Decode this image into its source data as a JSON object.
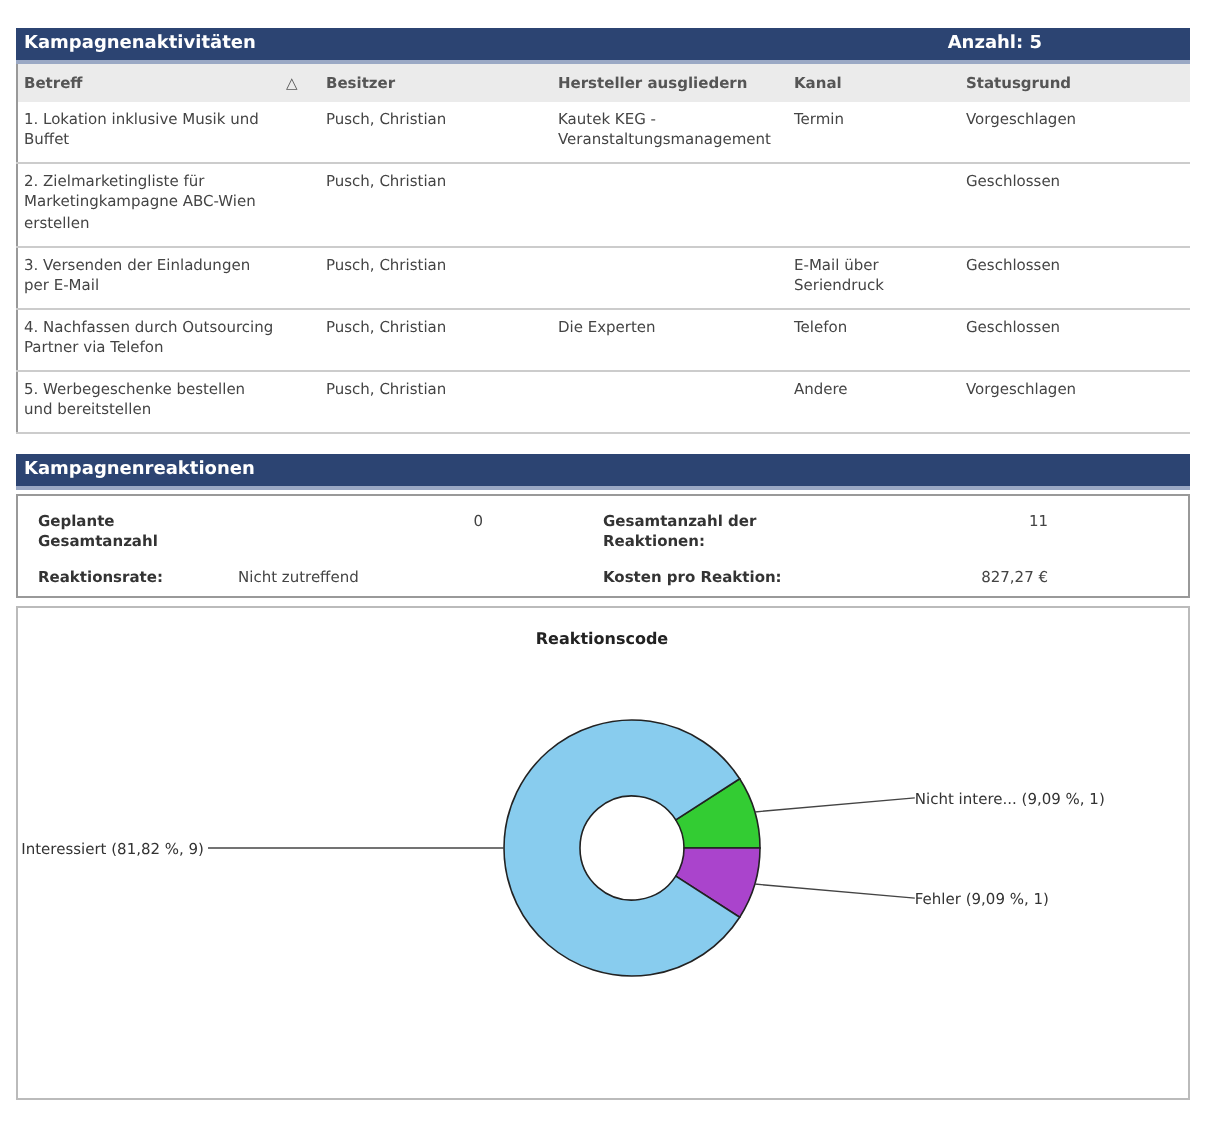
{
  "activities": {
    "title": "Kampagnenaktivitäten",
    "count": "Anzahl: 5",
    "sort_indicator": "△",
    "columns": [
      "Betreff",
      "Besitzer",
      "Hersteller ausgliedern",
      "Kanal",
      "Statusgrund"
    ],
    "rows": [
      {
        "cells": [
          "1. Lokation inklusive Musik und Buffet",
          "Pusch, Christian",
          "Kautek KEG - Veranstaltungsmanagement",
          "Termin",
          "Vorgeschlagen"
        ]
      },
      {
        "cells": [
          "2. Zielmarketingliste für Marketingkampagne ABC-Wien erstellen",
          "Pusch, Christian",
          "",
          "",
          "Geschlossen"
        ]
      },
      {
        "cells": [
          "3. Versenden der Einladungen per E-Mail",
          "Pusch, Christian",
          "",
          "E-Mail über Seriendruck",
          "Geschlossen"
        ]
      },
      {
        "cells": [
          "4. Nachfassen durch Outsourcing Partner via Telefon",
          "Pusch, Christian",
          "Die Experten",
          "Telefon",
          "Geschlossen"
        ]
      },
      {
        "cells": [
          "5. Werbegeschenke bestellen und bereitstellen",
          "Pusch, Christian",
          "",
          "Andere",
          "Vorgeschlagen"
        ]
      }
    ]
  },
  "responses": {
    "title": "Kampagnenreaktionen",
    "fields": [
      {
        "label": "Geplante Gesamtanzahl",
        "value": "0",
        "numeric": true
      },
      {
        "label": "Gesamtanzahl der Reaktionen:",
        "value": "11",
        "numeric": true
      },
      {
        "label": "Reaktionsrate:",
        "value": "Nicht zutreffend",
        "numeric": false
      },
      {
        "label": "Kosten pro Reaktion:",
        "value": "827,27 €",
        "numeric": true
      }
    ]
  },
  "chart": {
    "chart_data": {
      "type": "donut",
      "title": "Reaktionscode",
      "categories": [
        "Nicht intere...",
        "Fehler",
        "Interessiert"
      ],
      "values": [
        1,
        1,
        9
      ],
      "colors": [
        "#33cc33",
        "#aa44cc",
        "#88ccee"
      ],
      "value_labels": [
        "(9,09 %, 1)",
        "(9,09 %, 1)",
        "(81,82 %, 9)"
      ]
    }
  }
}
